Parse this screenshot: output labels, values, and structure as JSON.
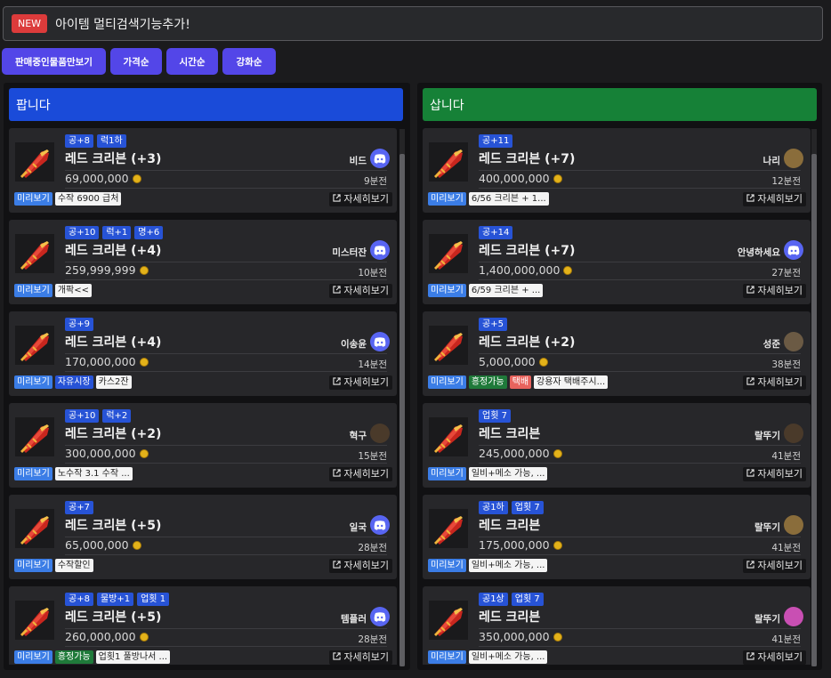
{
  "notice": {
    "badge": "NEW",
    "text": "아이템 멀티검색기능추가!"
  },
  "filters": [
    "판매중인물품만보기",
    "가격순",
    "시간순",
    "강화순"
  ],
  "sell": {
    "header": "팝니다",
    "items": [
      {
        "tags": [
          "공+8",
          "럭1하"
        ],
        "title": "레드 크리븐 (+3)",
        "price": "69,000,000",
        "seller": "비드",
        "avatar": "discord-icon",
        "time": "9분전",
        "extras": [
          {
            "kind": "note",
            "text": "수작 6900 급처"
          }
        ]
      },
      {
        "tags": [
          "공+10",
          "럭+1",
          "명+6"
        ],
        "title": "레드 크리븐 (+4)",
        "price": "259,999,999",
        "seller": "미스터잔",
        "avatar": "discord-icon",
        "time": "10분전",
        "extras": [
          {
            "kind": "note",
            "text": "개팍<<"
          }
        ]
      },
      {
        "tags": [
          "공+9"
        ],
        "title": "레드 크리븐 (+4)",
        "price": "170,000,000",
        "seller": "이송윤",
        "avatar": "discord-icon",
        "time": "14분전",
        "extras": [
          {
            "kind": "blue",
            "text": "자유시장"
          },
          {
            "kind": "note",
            "text": "카스2잔"
          }
        ]
      },
      {
        "tags": [
          "공+10",
          "럭+2"
        ],
        "title": "레드 크리븐 (+2)",
        "price": "300,000,000",
        "seller": "혁구",
        "avatar": "photo-avatar",
        "time": "15분전",
        "extras": [
          {
            "kind": "note",
            "text": "노수작 3.1 수작 ..."
          }
        ]
      },
      {
        "tags": [
          "공+7"
        ],
        "title": "레드 크리븐 (+5)",
        "price": "65,000,000",
        "seller": "일국",
        "avatar": "discord-icon",
        "time": "28분전",
        "extras": [
          {
            "kind": "note",
            "text": "수작할인"
          }
        ]
      },
      {
        "tags": [
          "공+8",
          "물방+1",
          "업횟 1"
        ],
        "title": "레드 크리븐 (+5)",
        "price": "260,000,000",
        "seller": "템플러",
        "avatar": "discord-icon",
        "time": "28분전",
        "extras": [
          {
            "kind": "green",
            "text": "흥정가능"
          },
          {
            "kind": "note",
            "text": "업횟1 풀방나서 ..."
          }
        ]
      }
    ]
  },
  "buy": {
    "header": "삽니다",
    "items": [
      {
        "tags": [
          "공+11"
        ],
        "title": "레드 크리븐 (+7)",
        "price": "400,000,000",
        "seller": "나리",
        "avatar": "photo-avatar",
        "time": "12분전",
        "extras": [
          {
            "kind": "note",
            "text": "6/56 크리븐 + 1..."
          }
        ]
      },
      {
        "tags": [
          "공+14"
        ],
        "title": "레드 크리븐 (+7)",
        "price": "1,400,000,000",
        "seller": "안녕하세요",
        "avatar": "discord-icon",
        "time": "27분전",
        "extras": [
          {
            "kind": "note",
            "text": "6/59 크리븐 + ..."
          }
        ]
      },
      {
        "tags": [
          "공+5"
        ],
        "title": "레드 크리븐 (+2)",
        "price": "5,000,000",
        "seller": "성준",
        "avatar": "photo-avatar",
        "time": "38분전",
        "extras": [
          {
            "kind": "green",
            "text": "흥정가능"
          },
          {
            "kind": "red",
            "text": "택배"
          },
          {
            "kind": "note",
            "text": "강용자 택배주시..."
          }
        ]
      },
      {
        "tags": [
          "업횟 7"
        ],
        "title": "레드 크리븐",
        "price": "245,000,000",
        "seller": "랄뚜기",
        "avatar": "photo-avatar",
        "time": "41분전",
        "extras": [
          {
            "kind": "note",
            "text": "일비+메소 가능, ..."
          }
        ]
      },
      {
        "tags": [
          "공1하",
          "업횟 7"
        ],
        "title": "레드 크리븐",
        "price": "175,000,000",
        "seller": "랄뚜기",
        "avatar": "photo-avatar",
        "time": "41분전",
        "extras": [
          {
            "kind": "note",
            "text": "일비+메소 가능, ..."
          }
        ]
      },
      {
        "tags": [
          "공1상",
          "업횟 7"
        ],
        "title": "레드 크리븐",
        "price": "350,000,000",
        "seller": "랄뚜기",
        "avatar": "photo-avatar",
        "time": "41분전",
        "extras": [
          {
            "kind": "note",
            "text": "일비+메소 가능, ..."
          }
        ]
      }
    ]
  },
  "labels": {
    "preview": "미리보기",
    "detail": "자세히보기"
  },
  "colors": {
    "accent": "#5346e8",
    "sell_header": "#1a4bd9",
    "buy_header": "#168137",
    "discord": "#5865f2"
  }
}
